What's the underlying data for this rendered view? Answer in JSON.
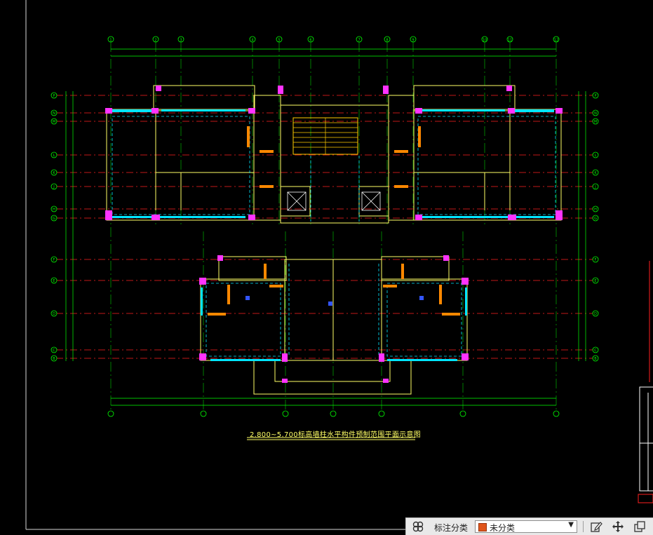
{
  "drawing": {
    "title": "2.800~5.700标高墙柱水平构件预制范围平面示意图",
    "axis_labels_top": [
      "1",
      "2",
      "3",
      "4",
      "5",
      "6",
      "7",
      "8",
      "9",
      "10",
      "11",
      "12",
      "13",
      "14",
      "17"
    ],
    "axis_labels_side": [
      "P",
      "N",
      "M",
      "L",
      "K",
      "J",
      "H",
      "G",
      "F",
      "E",
      "D",
      "C",
      "B",
      "A"
    ]
  },
  "toolbar": {
    "label": "标注分类",
    "dropdown_value": "未分类",
    "swatch_color": "#e0561c"
  },
  "colors": {
    "background": "#000000",
    "grid_axis": "#00ff00",
    "axis_dash": "#ff2020",
    "wall": "#ffff66",
    "magenta": "#ff33ff",
    "cyan": "#00e5ff",
    "orange": "#ff8800",
    "blue": "#3355ff"
  },
  "icons": [
    "view-mode-icon",
    "edit-icon",
    "move-icon",
    "copy-icon"
  ]
}
